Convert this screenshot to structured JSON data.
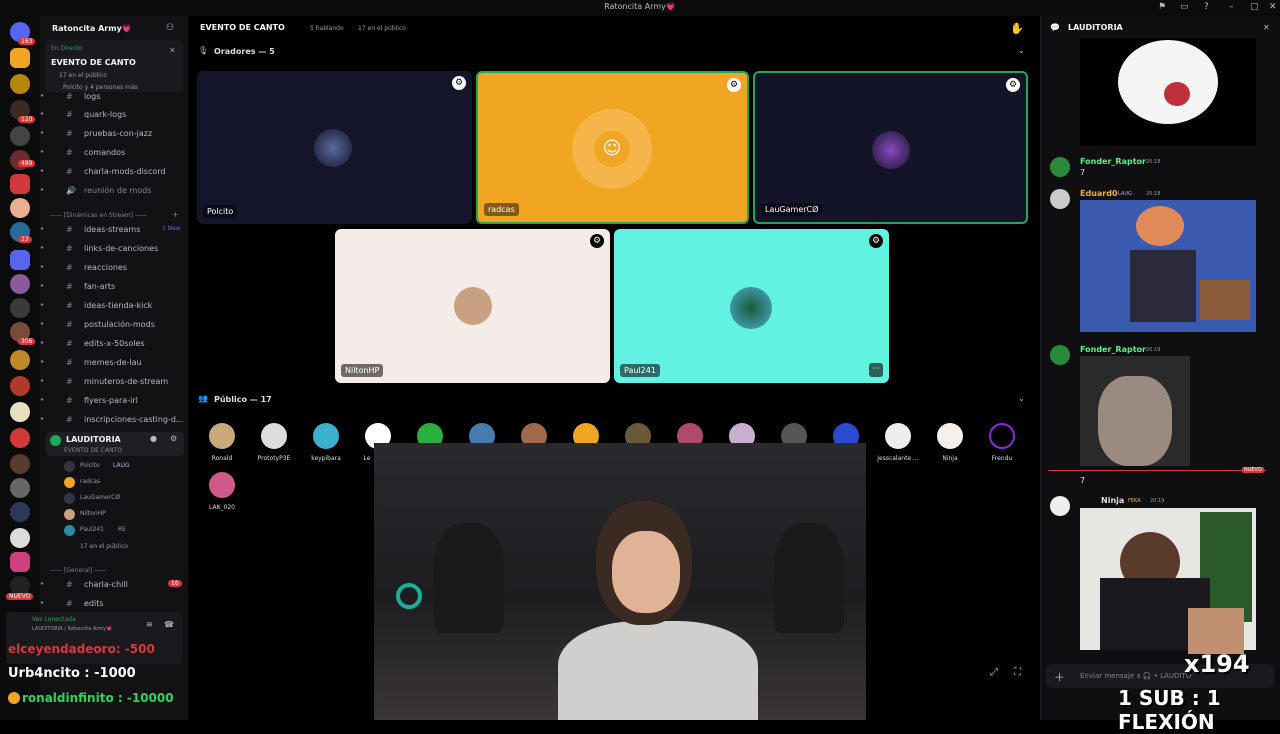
{
  "window": {
    "title": "Ratoncita Army💗"
  },
  "server": {
    "name": "Ratoncita Army💗",
    "live_status": "En Directo",
    "event_title": "EVENTO DE CANTO",
    "event_stage": "LAUDITORIA",
    "event_audience": "17 en el público",
    "event_people": "Polcito y 4 personas más",
    "badges": [
      "163",
      "1",
      "120",
      "489",
      "23",
      "66",
      "306",
      "23",
      "NUEVO"
    ]
  },
  "channels": [
    {
      "icon": "#",
      "label": "logs"
    },
    {
      "icon": "#",
      "label": "quark-logs"
    },
    {
      "icon": "#",
      "label": "pruebas-con-jazz"
    },
    {
      "icon": "#",
      "label": "comandos"
    },
    {
      "icon": "#",
      "label": "charla-mods-discord"
    },
    {
      "icon": "🔊",
      "label": "reunión de mods"
    }
  ],
  "category_streams": "—— [Dinámicas en Stream] ——",
  "channels2": [
    {
      "icon": "#",
      "label": "ideas-streams",
      "badge": "1 New"
    },
    {
      "icon": "#",
      "label": "links-de-canciones"
    },
    {
      "icon": "#",
      "label": "reacciones"
    },
    {
      "icon": "#",
      "label": "fan-arts"
    },
    {
      "icon": "#",
      "label": "ideas-tienda-kick"
    },
    {
      "icon": "#",
      "label": "postulación-mods"
    },
    {
      "icon": "#",
      "label": "edits-x-50soles"
    },
    {
      "icon": "#",
      "label": "memes-de-lau"
    },
    {
      "icon": "#",
      "label": "minuteros-de-stream"
    },
    {
      "icon": "#",
      "label": "flyers-para-irl"
    },
    {
      "icon": "#",
      "label": "inscripciones-casting-d..."
    }
  ],
  "voice_channel": {
    "label": "LAUDITORIA",
    "sub": "EVENTO DE CANTO",
    "users": [
      "Polcito",
      "radcas",
      "LauGamerCØ",
      "NiltonHP",
      "Paul241"
    ],
    "polcito_tag": "LAUG",
    "paul_tag": "RE",
    "audience": "17 en el público"
  },
  "category_general": "—— [General] ——",
  "channels3": [
    {
      "icon": "#",
      "label": "charla-chill",
      "badge": "16"
    },
    {
      "icon": "#",
      "label": "edits"
    }
  ],
  "voice_connected": {
    "status": "Voz conectada",
    "where": "LAUDITORIA / Ratoncita Army💗"
  },
  "stage": {
    "title": "EVENTO DE CANTO",
    "speaking": "5 hablando",
    "audience": "17 en el público",
    "speakers_header": "Oradores — 5",
    "speakers": [
      {
        "name": "Polcito",
        "bg": "#14142a"
      },
      {
        "name": "radcas",
        "bg": "#f0a523"
      },
      {
        "name": "LauGamerCØ",
        "bg": "#141428"
      },
      {
        "name": "NiltonHP",
        "bg": "#f5ece9"
      },
      {
        "name": "Paul241",
        "bg": "#61f2e2"
      }
    ],
    "audience_header": "Público — 17",
    "audience_list": [
      "Ronald",
      "PrototyP3E",
      "keypibara",
      "Le",
      "",
      "",
      "",
      "",
      "",
      "",
      "",
      "",
      "Jesscalante ...",
      "Ninja",
      "Frendu",
      "LAK_020"
    ]
  },
  "chat": {
    "header": "LAUDITORIA",
    "messages": [
      {
        "author": "Fonder_Raptor",
        "time": "20:18",
        "text": "7",
        "color": "#57f287"
      },
      {
        "author": "Eduard0",
        "tag": "LAUG",
        "time": "20:18",
        "text": "",
        "color": "#f0b232"
      },
      {
        "author": "Fonder_Raptor",
        "time": "20:19",
        "text": "",
        "color": "#57f287"
      },
      {
        "author": "Ninja",
        "tag": "FEKA",
        "time": "20:19",
        "text": "7",
        "color": "#dbdee1"
      }
    ],
    "new_label": "NUEVO",
    "composer_placeholder": "Enviar mensaje a 🎧 • LAUDITO"
  },
  "overlay": {
    "line1": "elceyendadeoro: -500",
    "line2": "Urb4ncito : -1000",
    "line3": "ronaldinfinito : -10000",
    "counter": "x194",
    "rule": "1 SUB : 1 FLEXIÓN"
  },
  "colors": {
    "accent": "#5865f2",
    "online": "#23a55a",
    "danger": "#da373c"
  }
}
